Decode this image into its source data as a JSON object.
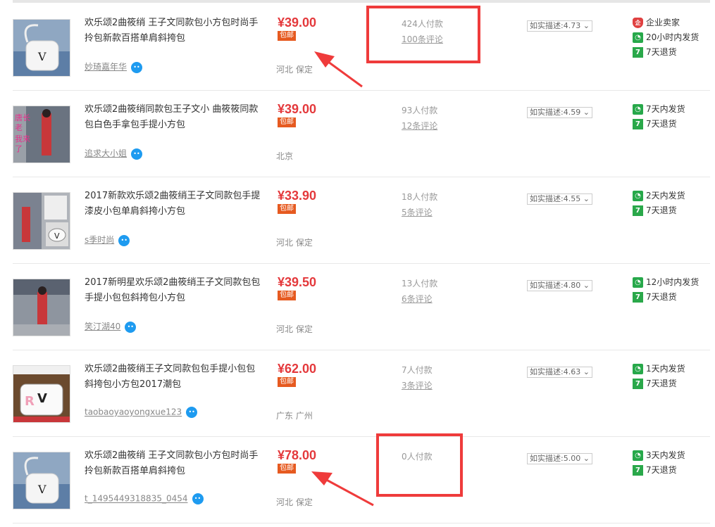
{
  "colors": {
    "price": "#e4393c",
    "baoyou_bg": "#e65a20",
    "annotation": "#ef3b3b",
    "badge_green": "#27a84a",
    "wangwang": "#1e9bf0"
  },
  "badge_labels": {
    "baoyou": "包邮",
    "enterprise": "企",
    "seven": "7"
  },
  "listings": [
    {
      "title": "欢乐颂2曲筱绡 王子文同款包小方包时尚手拎包新款百搭单肩斜挎包",
      "shop": "妙琦嘉年华",
      "price": "¥39.00",
      "location": "河北 保定",
      "paid": "424人付款",
      "reviews": "100条评论",
      "rating": "如实描述:4.73",
      "services": [
        {
          "icon": "enterprise-icon",
          "label": "企业卖家"
        },
        {
          "icon": "clock-icon",
          "label": "20小时内发货"
        },
        {
          "icon": "seven-day-icon",
          "label": "7天退货"
        }
      ],
      "thumb": "white-bag-denim"
    },
    {
      "title": "欢乐颂2曲筱绡同款包王子文小 曲筱筱同款包白色手拿包手提小方包",
      "shop": "追求大小姐",
      "price": "¥39.00",
      "location": "北京",
      "paid": "93人付款",
      "reviews": "12条评论",
      "rating": "如实描述:4.59",
      "services": [
        {
          "icon": "clock-icon",
          "label": "7天内发货"
        },
        {
          "icon": "seven-day-icon",
          "label": "7天退货"
        }
      ],
      "thumb": "street-photo-pink-text",
      "thumb_text": "唐长老我来了"
    },
    {
      "title": "2017新款欢乐颂2曲筱绡王子文同款包手提漆皮小包单肩斜挎小方包",
      "shop": "s季时尚",
      "price": "¥33.90",
      "location": "河北 保定",
      "paid": "18人付款",
      "reviews": "5条评论",
      "rating": "如实描述:4.55",
      "services": [
        {
          "icon": "clock-icon",
          "label": "2天内发货"
        },
        {
          "icon": "seven-day-icon",
          "label": "7天退货"
        }
      ],
      "thumb": "collage"
    },
    {
      "title": "2017新明星欢乐颂2曲筱绡王子文同款包包手提小包包斜挎包小方包",
      "shop": "笑汀湖40",
      "price": "¥39.50",
      "location": "河北 保定",
      "paid": "13人付款",
      "reviews": "6条评论",
      "rating": "如实描述:4.80",
      "services": [
        {
          "icon": "clock-icon",
          "label": "12小时内发货"
        },
        {
          "icon": "seven-day-icon",
          "label": "7天退货"
        }
      ],
      "thumb": "street-photo"
    },
    {
      "title": "欢乐颂2曲筱绡王子文同款包包手提小包包斜挎包小方包2017潮包",
      "shop": "taobaoyaoyongxue123",
      "price": "¥62.00",
      "location": "广东 广州",
      "paid": "7人付款",
      "reviews": "3条评论",
      "rating": "如实描述:4.63",
      "services": [
        {
          "icon": "clock-icon",
          "label": "1天内发货"
        },
        {
          "icon": "seven-day-icon",
          "label": "7天退货"
        }
      ],
      "thumb": "rv-bag"
    },
    {
      "title": "欢乐颂2曲筱绡 王子文同款包小方包时尚手拎包新款百搭单肩斜挎包",
      "shop": "t_1495449318835_0454",
      "price": "¥78.00",
      "location": "河北 保定",
      "paid": "0人付款",
      "reviews": "",
      "rating": "如实描述:5.00",
      "services": [
        {
          "icon": "clock-icon",
          "label": "3天内发货"
        },
        {
          "icon": "seven-day-icon",
          "label": "7天退货"
        }
      ],
      "thumb": "white-bag-denim"
    }
  ]
}
